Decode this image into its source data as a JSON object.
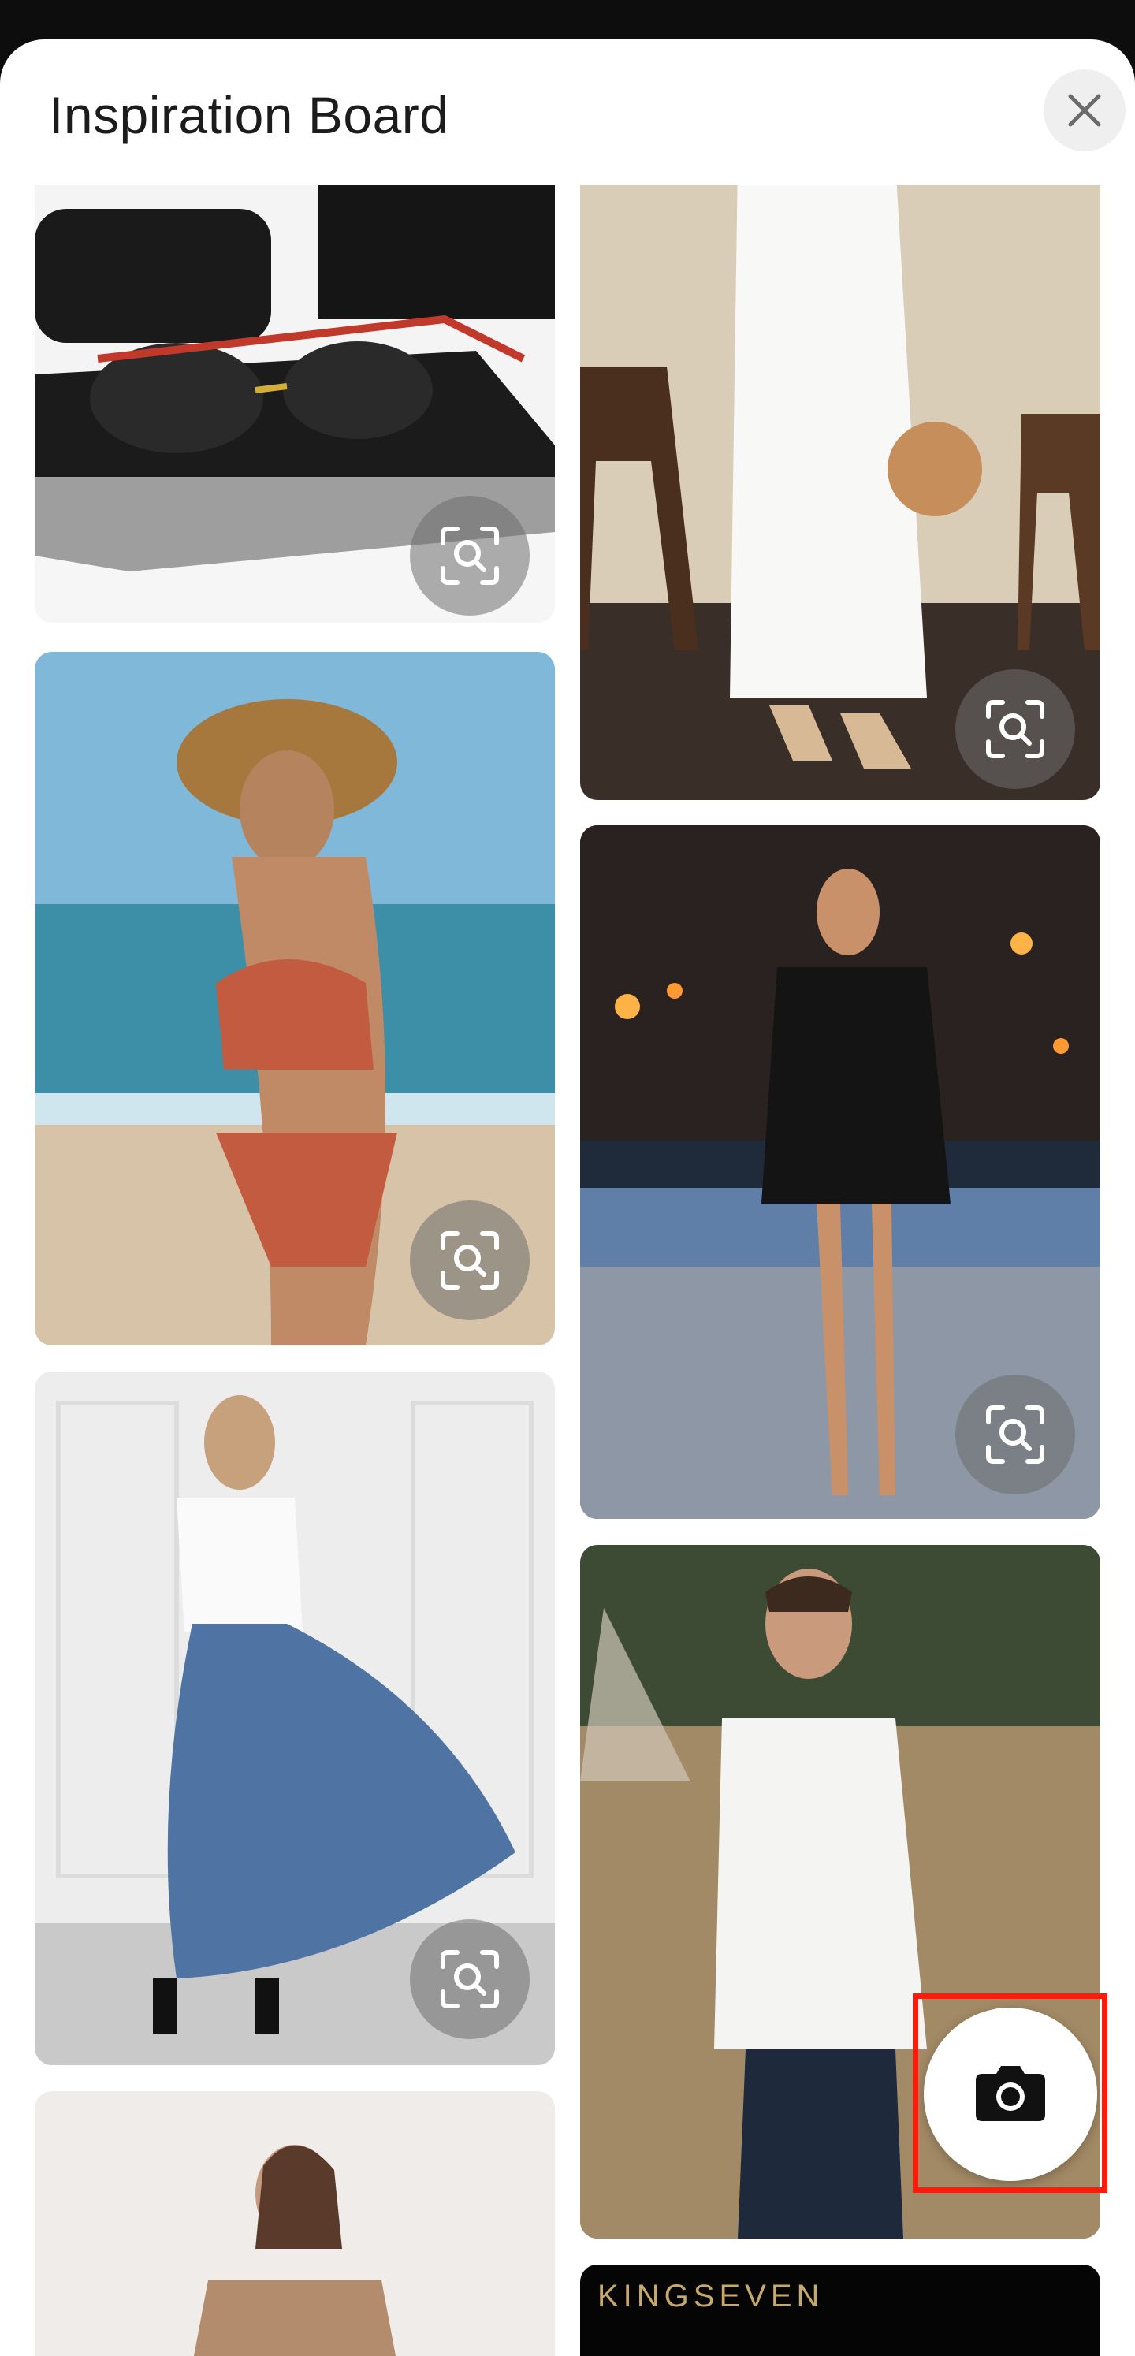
{
  "header": {
    "title": "Inspiration Board",
    "close_label": "Close"
  },
  "cards": [
    {
      "id": "sunglasses",
      "description": "aviator sunglasses with case"
    },
    {
      "id": "white-dress",
      "description": "white dress with round bag"
    },
    {
      "id": "bikini",
      "description": "rust bikini and straw hat on beach"
    },
    {
      "id": "sequin-blazer",
      "description": "sequin blazer dress at night"
    },
    {
      "id": "blue-skirt",
      "description": "blue maxi skirt with white tee"
    },
    {
      "id": "white-sweater",
      "description": "white sweatshirt and jeans"
    },
    {
      "id": "tan-top",
      "description": "tan top outfit"
    },
    {
      "id": "brand-banner",
      "brand": "KINGSEVEN"
    }
  ],
  "camera_button": {
    "label": "camera",
    "highlighted": true
  },
  "colors": {
    "highlight": "#ff1a0a",
    "brand_gold": "#c6a96a",
    "lens_button": "#6e6e6e"
  },
  "icons": [
    "close-icon",
    "visual-search-icon",
    "camera-icon"
  ]
}
